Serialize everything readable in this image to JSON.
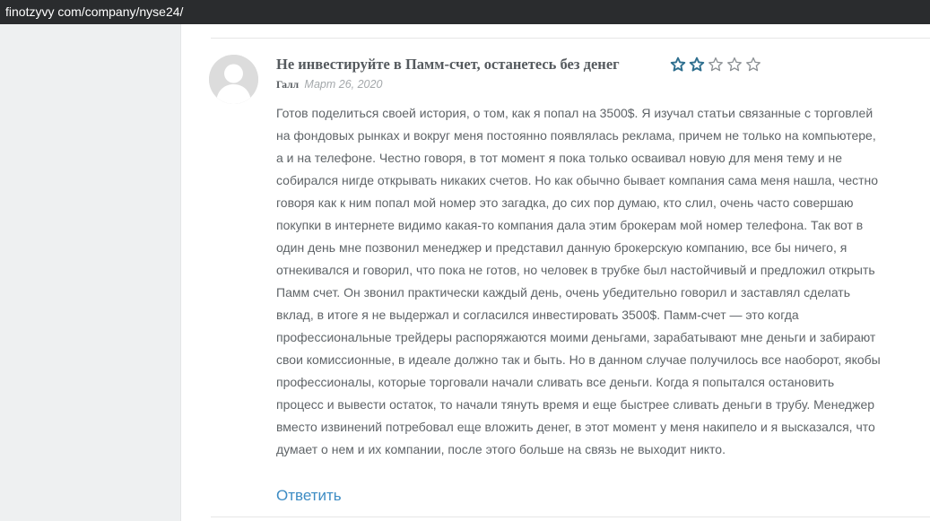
{
  "browser": {
    "url": "finotzyvy com/company/nyse24/"
  },
  "review": {
    "title": "Не инвестируйте в Памм-счет, останетесь без денег",
    "rating": 2,
    "rating_max": 5,
    "star_color": "#2e6f8f",
    "author": "Галл",
    "date": "Март 26, 2020",
    "body_lines": [
      "Готов поделиться своей история, о том, как я попал на 3500$. Я изучал статьи связанные с торговлей",
      "на фондовых рынках и вокруг меня постоянно появлялась реклама, причем не только на компьютере,",
      "а и на телефоне. Честно говоря, в тот момент я пока только осваивал новую для меня тему и не",
      "собирался нигде открывать никаких счетов. Но как обычно бывает компания сама меня нашла, честно",
      "говоря как к ним попал мой номер это загадка, до сих пор думаю, кто слил, очень часто совершаю",
      "покупки в интернете видимо какая-то компания дала этим брокерам мой номер телефона. Так вот в",
      "один день мне позвонил менеджер и представил данную брокерскую компанию, все бы ничего, я",
      "отнекивался и говорил, что пока не готов, но человек в трубке был настойчивый и предложил открыть",
      "Памм счет. Он звонил практически каждый день, очень убедительно говорил и заставлял сделать",
      "вклад, в итоге я не выдержал и согласился инвестировать 3500$. Памм-счет — это когда",
      "профессиональные трейдеры распоряжаются моими деньгами, зарабатывают мне деньги и забирают",
      "свои комиссионные, в идеале должно так и быть. Но в данном случае получилось все наоборот, якобы",
      "профессионалы, которые торговали начали сливать все деньги. Когда я попытался остановить",
      "процесс и вывести остаток, то начали тянуть время и еще быстрее сливать деньги в трубу. Менеджер",
      "вместо извинений потребовал еще вложить денег, в этот момент у меня накипело и я высказался, что",
      "думает о нем и их компании, после этого больше на связь не выходит никто."
    ],
    "reply_label": "Ответить",
    "reply_color": "#3d8cc4"
  }
}
